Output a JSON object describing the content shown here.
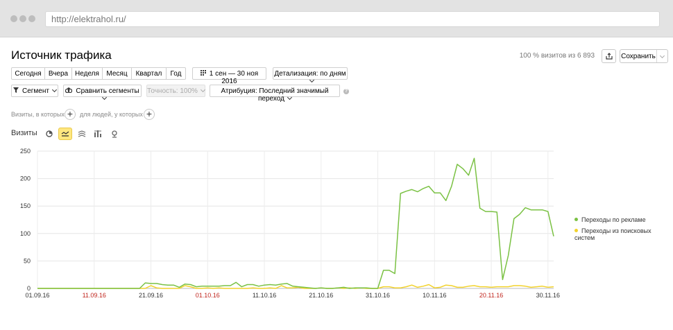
{
  "browser": {
    "url": "http://elektrahol.ru/"
  },
  "header": {
    "title": "Источник трафика",
    "visits_info": "100 % визитов из 6 893",
    "save_label": "Сохранить"
  },
  "period": {
    "buttons": [
      "Сегодня",
      "Вчера",
      "Неделя",
      "Месяц",
      "Квартал",
      "Год"
    ],
    "date_range": "1 сен — 30 ноя 2016",
    "detail": "Детализация: по дням"
  },
  "toolbar": {
    "segment": "Сегмент",
    "compare": "Сравнить сегменты",
    "accuracy": "Точность: 100%",
    "attribution": "Атрибуция: Последний значимый переход",
    "help": "?"
  },
  "filter": {
    "visits_text": "Визиты, в которых",
    "people_text": "для людей, у которых"
  },
  "chart_section": {
    "title": "Визиты"
  },
  "chart_data": {
    "type": "line",
    "ylim": [
      0,
      250
    ],
    "yticks": [
      0,
      50,
      100,
      150,
      200,
      250
    ],
    "xticks": [
      {
        "label": "01.09.16",
        "day": 0,
        "weekend": false
      },
      {
        "label": "11.09.16",
        "day": 10,
        "weekend": true
      },
      {
        "label": "21.09.16",
        "day": 20,
        "weekend": false
      },
      {
        "label": "01.10.16",
        "day": 30,
        "weekend": true
      },
      {
        "label": "11.10.16",
        "day": 40,
        "weekend": false
      },
      {
        "label": "21.10.16",
        "day": 50,
        "weekend": false
      },
      {
        "label": "31.10.16",
        "day": 60,
        "weekend": false
      },
      {
        "label": "10.11.16",
        "day": 70,
        "weekend": false
      },
      {
        "label": "20.11.16",
        "day": 80,
        "weekend": true
      },
      {
        "label": "30.11.16",
        "day": 90,
        "weekend": false
      }
    ],
    "colors": {
      "ads": "#7ac143",
      "search": "#f2d22b"
    },
    "series": [
      {
        "name": "Переходы по рекламе",
        "values": [
          0,
          0,
          0,
          0,
          0,
          0,
          0,
          0,
          0,
          0,
          0,
          0,
          0,
          0,
          0,
          0,
          0,
          0,
          0,
          10,
          9,
          9,
          7,
          6,
          6,
          2,
          8,
          7,
          3,
          4,
          4,
          4,
          4,
          5,
          5,
          11,
          3,
          7,
          7,
          4,
          6,
          7,
          6,
          8,
          9,
          4,
          3,
          2,
          1,
          0,
          1,
          0,
          0,
          1,
          2,
          0,
          1,
          1,
          1,
          0,
          0,
          33,
          33,
          27,
          173,
          177,
          180,
          176,
          182,
          186,
          174,
          174,
          160,
          186,
          226,
          218,
          206,
          237,
          146,
          140,
          140,
          139,
          16,
          60,
          127,
          135,
          147,
          143,
          143,
          143,
          140,
          95
        ]
      },
      {
        "name": "Переходы из поисковых систем",
        "values": [
          0,
          0,
          0,
          0,
          0,
          0,
          0,
          0,
          0,
          0,
          0,
          0,
          0,
          0,
          0,
          0,
          0,
          0,
          0,
          0,
          5,
          1,
          0,
          0,
          0,
          0,
          5,
          3,
          0,
          0,
          1,
          0,
          1,
          0,
          0,
          0,
          0,
          0,
          1,
          0,
          0,
          1,
          0,
          5,
          1,
          1,
          2,
          0,
          0,
          0,
          1,
          0,
          0,
          1,
          0,
          1,
          0,
          1,
          0,
          0,
          0,
          3,
          3,
          1,
          1,
          3,
          6,
          2,
          4,
          7,
          1,
          2,
          6,
          5,
          2,
          2,
          4,
          5,
          3,
          3,
          2,
          3,
          3,
          3,
          5,
          5,
          4,
          2,
          3,
          4,
          2,
          3
        ]
      }
    ]
  }
}
